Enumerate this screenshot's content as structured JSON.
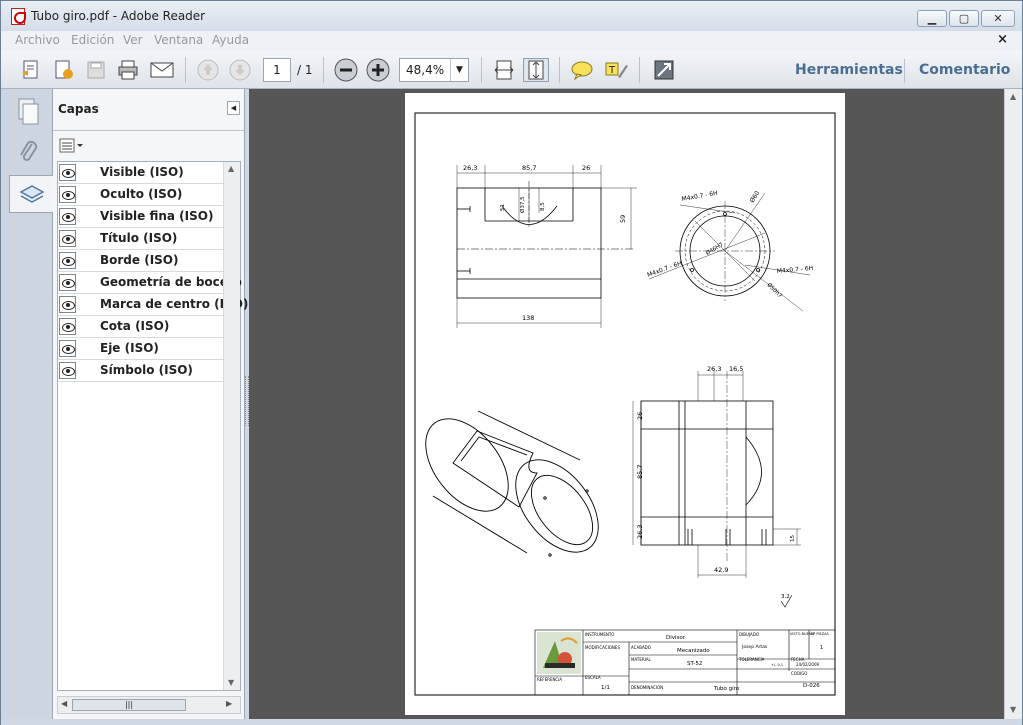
{
  "window": {
    "title": "Tubo giro.pdf - Adobe Reader"
  },
  "menu": [
    "Archivo",
    "Edición",
    "Ver",
    "Ventana",
    "Ayuda"
  ],
  "toolbar": {
    "page_current": "1",
    "page_total": "/ 1",
    "zoom": "48,4%",
    "tools_label": "Herramientas",
    "comment_label": "Comentario"
  },
  "panel": {
    "title": "Capas",
    "layers": [
      "Visible (ISO)",
      "Oculto (ISO)",
      "Visible fina (ISO)",
      "Título (ISO)",
      "Borde (ISO)",
      "Geometría de boceto",
      "Marca de centro (ISO)",
      "Cota (ISO)",
      "Eje (ISO)",
      "Símbolo (ISO)"
    ]
  },
  "drawing": {
    "front_dims": {
      "left": "26,3",
      "middle": "85,7",
      "right": "26",
      "height": "59",
      "length": "138",
      "d1": "51",
      "d2": "Ø37,5",
      "d3": "8,5"
    },
    "side_dims": {
      "thread_tl": "M4x0.7 - 6H",
      "thread_bl": "M4x0.7 - 6H",
      "thread_r": "M4x0.7 - 6H",
      "phi_outer": "Ø60",
      "phi_inner": "Ø46H7",
      "phi_bottom": "Ø50h7"
    },
    "bottom_dims": {
      "top1": "26,3",
      "top2": "16,5",
      "v1": "26",
      "v2": "85,7",
      "v3": "26,3",
      "slot": "15",
      "bottom": "42,9"
    },
    "roughness": "3,2",
    "titleblock": {
      "instrumento_label": "INSTRUMENTO",
      "instrumento": "Divisor",
      "dibujado_label": "DIBUJADO",
      "dibujado": "Josep Artas",
      "visto_label": "VISTO BUENO",
      "piezas_label": "Nº PIEZAS",
      "piezas": "1",
      "modificaciones_label": "MODIFICACIONES",
      "acabado_label": "ACABADO",
      "acabado": "Mecanizado",
      "material_label": "MATERIAL",
      "material": "ST-52",
      "tolerancia_label": "TOLERANCIA",
      "tolerancia": "+/- 0,1",
      "fecha_label": "FECHA",
      "fecha": "24/02/2009",
      "referencia_label": "REFERENCIA",
      "escala_label": "ESCALA",
      "escala": "1/1",
      "denominacion_label": "DENOMINACION",
      "denominacion": "Tubo giro",
      "codigo_label": "CODIGO",
      "codigo": "D-026"
    }
  }
}
